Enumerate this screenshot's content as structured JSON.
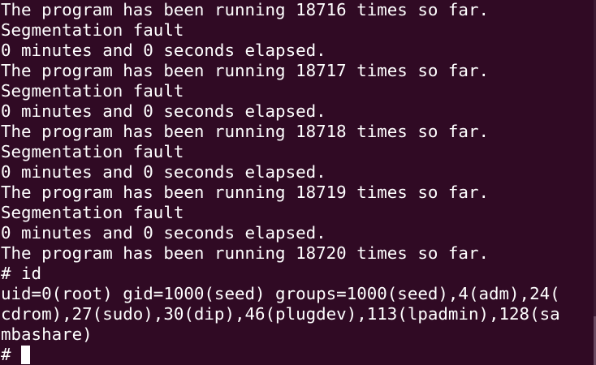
{
  "terminal": {
    "lines": [
      "The program has been running 18716 times so far.",
      "Segmentation fault",
      "0 minutes and 0 seconds elapsed.",
      "The program has been running 18717 times so far.",
      "Segmentation fault",
      "0 minutes and 0 seconds elapsed.",
      "The program has been running 18718 times so far.",
      "Segmentation fault",
      "0 minutes and 0 seconds elapsed.",
      "The program has been running 18719 times so far.",
      "Segmentation fault",
      "0 minutes and 0 seconds elapsed.",
      "The program has been running 18720 times so far.",
      "# id",
      "uid=0(root) gid=1000(seed) groups=1000(seed),4(adm),24(",
      "cdrom),27(sudo),30(dip),46(plugdev),113(lpadmin),128(sa",
      "mbashare)"
    ],
    "prompt": "#",
    "background_color": "#300a24",
    "text_color": "#ffffff"
  }
}
